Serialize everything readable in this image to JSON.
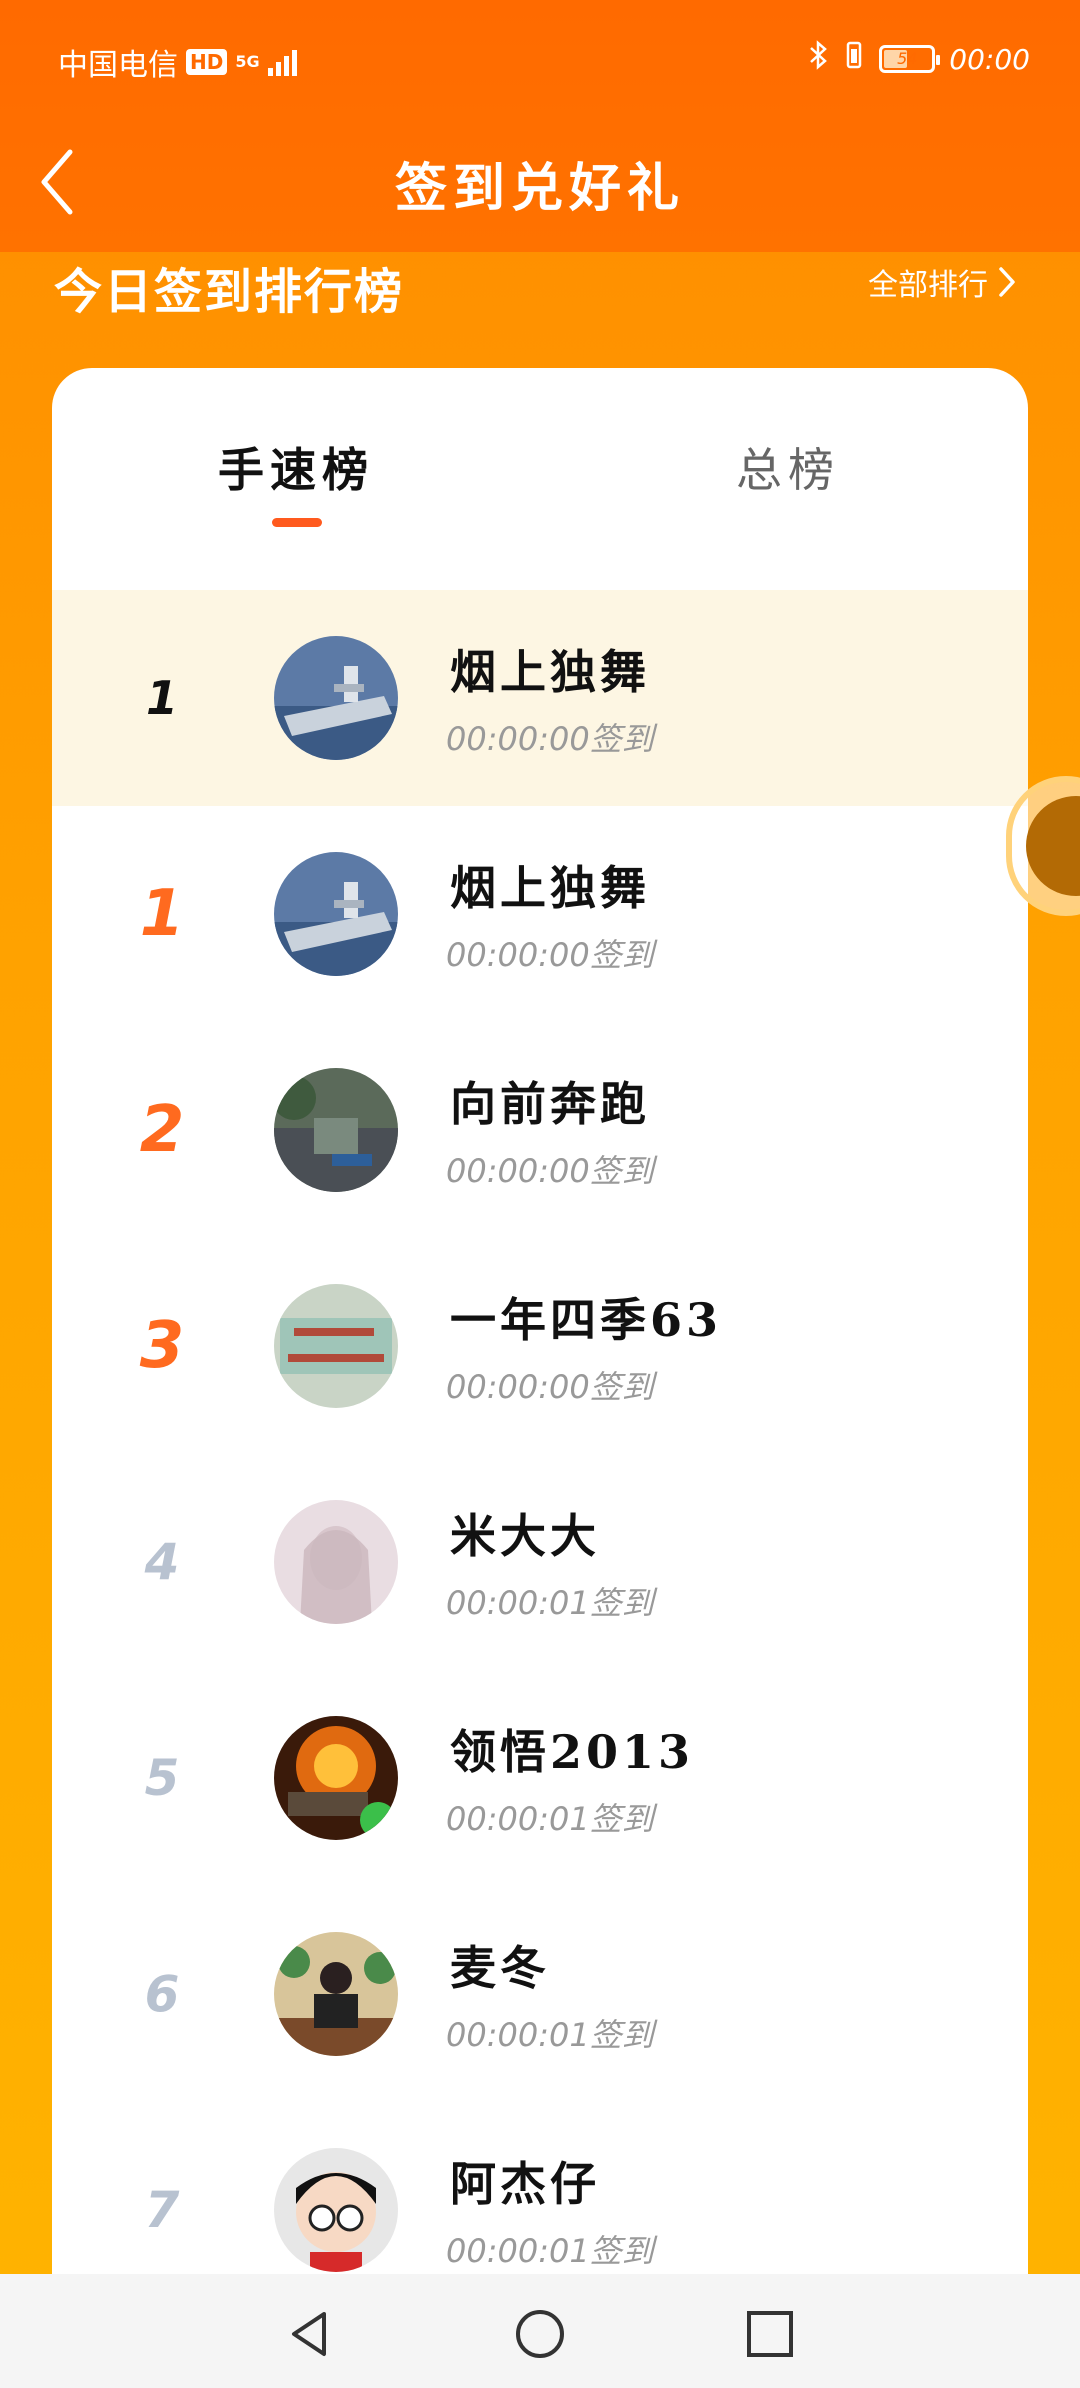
{
  "status": {
    "carrier": "中国电信",
    "hd": "HD",
    "network": "5G",
    "battery": "54",
    "time": "00:00"
  },
  "nav": {
    "title": "签到兑好礼"
  },
  "section": {
    "title": "今日签到排行榜",
    "all_rank": "全部排行"
  },
  "tabs": [
    {
      "label": "手速榜",
      "active": true
    },
    {
      "label": "总榜",
      "active": false
    }
  ],
  "my_rank": {
    "rank": "1",
    "name": "烟上独舞",
    "time": "00:00:00",
    "time_suffix": "签到"
  },
  "ranking": [
    {
      "rank": "1",
      "name": "烟上独舞",
      "time": "00:00:00",
      "suffix": "签到"
    },
    {
      "rank": "2",
      "name": "向前奔跑",
      "time": "00:00:00",
      "suffix": "签到"
    },
    {
      "rank": "3",
      "name": "一年四季63",
      "time": "00:00:00",
      "suffix": "签到"
    },
    {
      "rank": "4",
      "name": "米大大",
      "time": "00:00:01",
      "suffix": "签到"
    },
    {
      "rank": "5",
      "name": "领悟2013",
      "time": "00:00:01",
      "suffix": "签到"
    },
    {
      "rank": "6",
      "name": "麦冬",
      "time": "00:00:01",
      "suffix": "签到"
    },
    {
      "rank": "7",
      "name": "阿杰仔",
      "time": "00:00:01",
      "suffix": "签到"
    }
  ],
  "colors": {
    "header": "#ff6a00",
    "accent": "#ff5a1e",
    "highlight_row": "#fdf6e3"
  },
  "icons": [
    "back-icon",
    "chevron-right-icon",
    "bluetooth-icon",
    "battery-icon",
    "signal-icon",
    "nav-back-icon",
    "nav-home-icon",
    "nav-recents-icon"
  ]
}
